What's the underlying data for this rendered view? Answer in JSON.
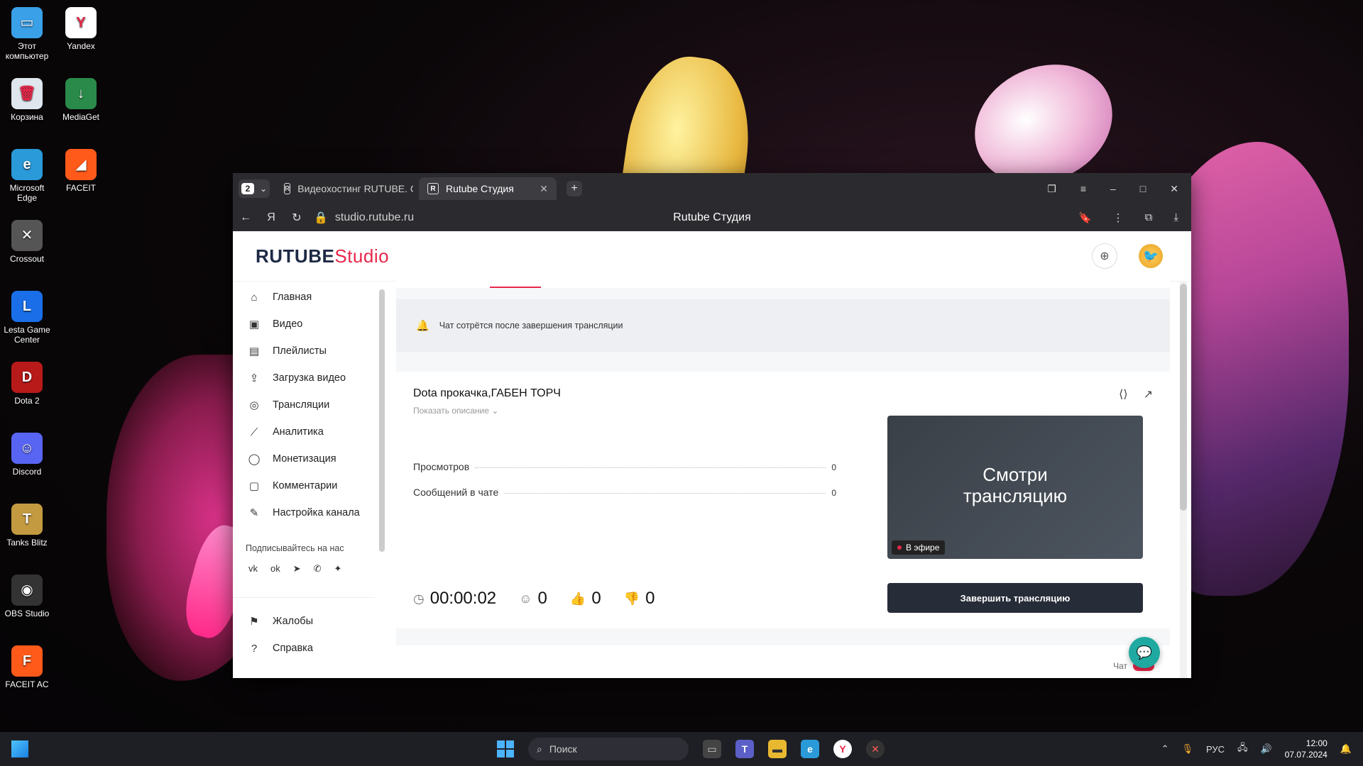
{
  "desktop_icons": [
    {
      "label": "Этот компьютер",
      "glyph": "▭",
      "icon": "monitor-icon",
      "color": "#3aa0e8"
    },
    {
      "label": "Корзина",
      "glyph": "🗑",
      "icon": "recycle-bin-icon",
      "color": "#dfe6ee"
    },
    {
      "label": "Microsoft Edge",
      "glyph": "e",
      "icon": "edge-icon",
      "color": "#2a9ad8"
    },
    {
      "label": "Crossout",
      "glyph": "✕",
      "icon": "crossout-icon",
      "color": "#555555"
    },
    {
      "label": "Lesta Game Center",
      "glyph": "L",
      "icon": "lesta-icon",
      "color": "#1a6fe8"
    },
    {
      "label": "Dota 2",
      "glyph": "D",
      "icon": "dota-icon",
      "color": "#b81a1a"
    },
    {
      "label": "Discord",
      "glyph": "☺",
      "icon": "discord-icon",
      "color": "#5865f2"
    },
    {
      "label": "Tanks Blitz",
      "glyph": "T",
      "icon": "tanks-blitz-icon",
      "color": "#c49a40"
    },
    {
      "label": "OBS Studio",
      "glyph": "◉",
      "icon": "obs-icon",
      "color": "#333333"
    },
    {
      "label": "FACEIT AC",
      "glyph": "F",
      "icon": "faceit-ac-icon",
      "color": "#ff5a1a"
    }
  ],
  "desktop_icons_col2": [
    {
      "label": "Yandex",
      "glyph": "Y",
      "icon": "yandex-icon",
      "color": "#ffffff"
    },
    {
      "label": "MediaGet",
      "glyph": "↓",
      "icon": "mediaget-icon",
      "color": "#2a8a4a"
    },
    {
      "label": "FACEIT",
      "glyph": "◢",
      "icon": "faceit-icon",
      "color": "#ff5a1a"
    }
  ],
  "browser": {
    "tab_count": "2",
    "tabs": [
      {
        "label": "Видеохостинг RUTUBE. С",
        "active": false
      },
      {
        "label": "Rutube Студия",
        "active": true
      }
    ],
    "url": "studio.rutube.ru",
    "page_title": "Rutube Студия"
  },
  "header": {
    "logo_main": "RUTUBE",
    "logo_accent": "Studio"
  },
  "sidebar": {
    "items": [
      {
        "label": "Главная",
        "icon": "home-icon",
        "glyph": "⌂"
      },
      {
        "label": "Видео",
        "icon": "video-icon",
        "glyph": "▣"
      },
      {
        "label": "Плейлисты",
        "icon": "playlist-icon",
        "glyph": "▤"
      },
      {
        "label": "Загрузка видео",
        "icon": "upload-icon",
        "glyph": "⇪"
      },
      {
        "label": "Трансляции",
        "icon": "broadcast-icon",
        "glyph": "◎"
      },
      {
        "label": "Аналитика",
        "icon": "analytics-icon",
        "glyph": "⟋"
      },
      {
        "label": "Монетизация",
        "icon": "monetization-icon",
        "glyph": "◯"
      },
      {
        "label": "Комментарии",
        "icon": "comments-icon",
        "glyph": "▢"
      },
      {
        "label": "Настройка канала",
        "icon": "settings-wand-icon",
        "glyph": "✎"
      }
    ],
    "subscribe_label": "Подписывайтесь на нас",
    "socials": [
      {
        "glyph": "vk",
        "icon": "vk-icon"
      },
      {
        "glyph": "ok",
        "icon": "odnoklassniki-icon"
      },
      {
        "glyph": "➤",
        "icon": "telegram-icon"
      },
      {
        "glyph": "✆",
        "icon": "viber-icon"
      },
      {
        "glyph": "✦",
        "icon": "dzen-icon"
      }
    ],
    "bottom_items": [
      {
        "label": "Жалобы",
        "icon": "flag-icon",
        "glyph": "⚑"
      },
      {
        "label": "Справка",
        "icon": "help-icon",
        "glyph": "?"
      }
    ]
  },
  "notice": {
    "text": "Чат сотрётся после завершения трансляции"
  },
  "stream": {
    "title": "Dota прокачка,ГАБЕН ТОРЧ",
    "show_description": "Показать описание",
    "stats": [
      {
        "label": "Просмотров",
        "value": "0"
      },
      {
        "label": "Сообщений в чате",
        "value": "0"
      }
    ],
    "duration": "00:00:02",
    "viewers": "0",
    "likes": "0",
    "dislikes": "0",
    "preview_title_1": "Смотри",
    "preview_title_2": "трансляцию",
    "live_label": "В эфире",
    "end_button": "Завершить трансляцию"
  },
  "chat_section": {
    "label": "Чат"
  },
  "taskbar": {
    "search_placeholder": "Поиск",
    "lang": "РУС",
    "time": "12:00",
    "date": "07.07.2024"
  },
  "colors": {
    "accent": "#e8274a",
    "dark_button": "#262c38",
    "fab": "#1fa9a0"
  }
}
